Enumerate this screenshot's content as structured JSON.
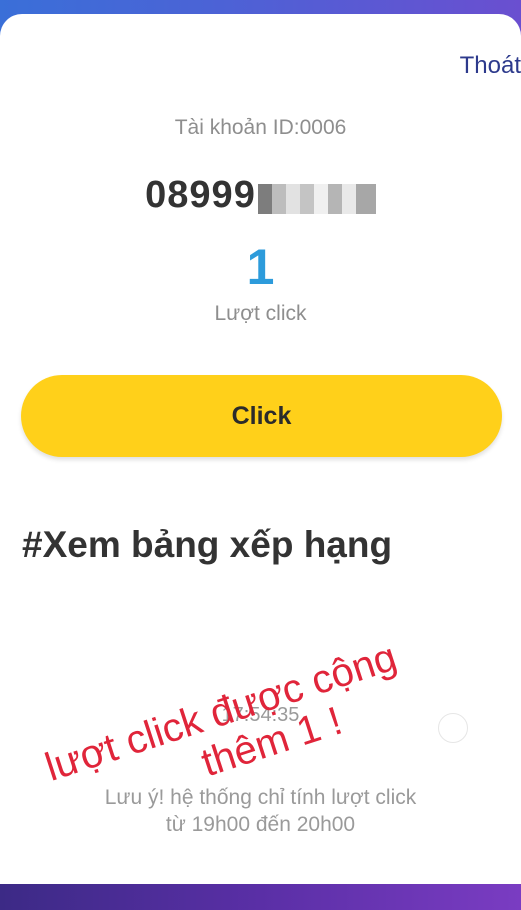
{
  "header": {
    "logout_label": "Thoát"
  },
  "account": {
    "id_label": "Tài khoản ID:0006",
    "phone_visible": "08999"
  },
  "stats": {
    "click_count": "1",
    "click_count_label": "Lượt click"
  },
  "actions": {
    "click_button_label": "Click",
    "ranking_link_label": "#Xem bảng xếp hạng"
  },
  "footer": {
    "clock": "17:54:35",
    "note_line1": "Lưu ý! hệ thống chỉ tính lượt click",
    "note_line2": "từ 19h00 đến 20h00"
  },
  "annotation": {
    "line1": "lượt click được cộng",
    "line2": "thêm 1 !"
  },
  "colors": {
    "button": "#ffd01a",
    "count": "#2d9bdb",
    "logout": "#2d3a8c",
    "annotation": "#e0253a"
  }
}
